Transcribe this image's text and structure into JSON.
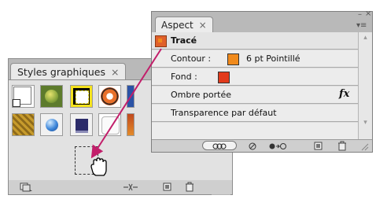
{
  "styles_panel": {
    "tab_label": "Styles graphiques",
    "tab_close": "×",
    "swatches": [
      {
        "name": "default-style-swatch"
      },
      {
        "name": "green-texture-swatch"
      },
      {
        "name": "dashed-yellow-swatch"
      },
      {
        "name": "orange-circle-swatch"
      },
      {
        "name": "gold-texture-swatch"
      },
      {
        "name": "blue-sphere-swatch"
      },
      {
        "name": "navy-square-swatch"
      },
      {
        "name": "white-rounded-swatch"
      }
    ],
    "scroll_down": "▾"
  },
  "aspect_panel": {
    "tab_label": "Aspect",
    "tab_close": "×",
    "window_close": "×",
    "window_minimize": "–",
    "menu": "▾≡",
    "header_label": "Tracé",
    "contour_label": "Contour :",
    "contour_value": "6 pt Pointillé",
    "fond_label": "Fond :",
    "shadow_label": "Ombre portée",
    "fx_label": "fx",
    "transparency_label": "Transparence par défaut",
    "scroll_up": "▴",
    "scroll_down": "▾"
  },
  "colors": {
    "stroke_swatch": "#f08a1c",
    "fill_swatch": "#e23b1c",
    "arrow": "#c21e6a"
  }
}
